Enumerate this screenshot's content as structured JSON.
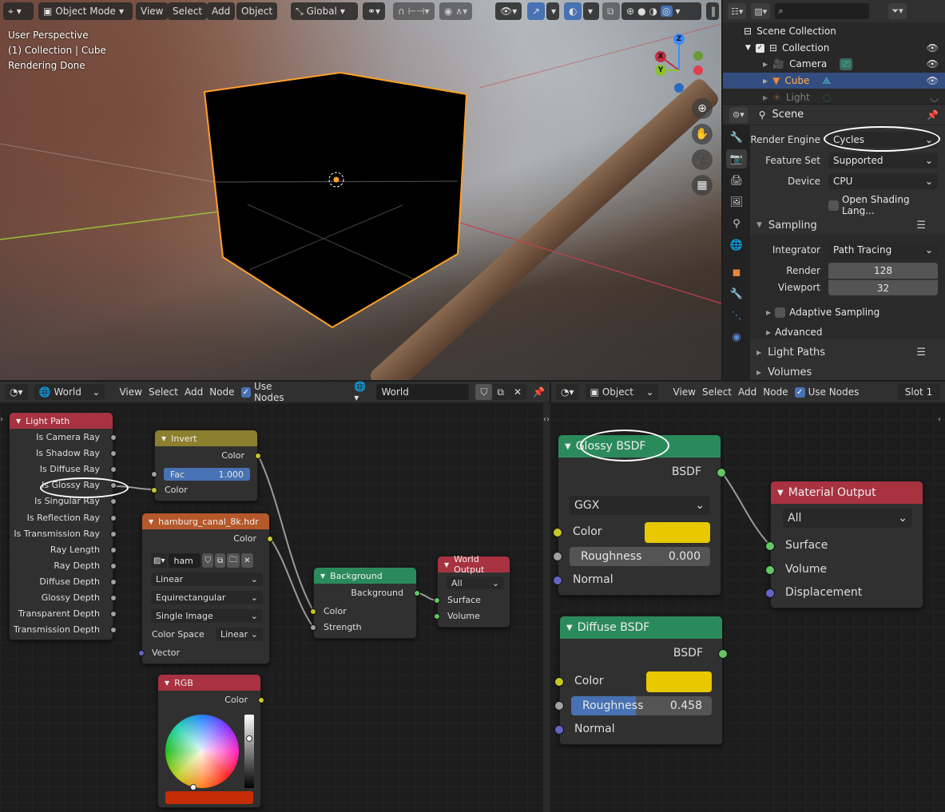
{
  "viewport": {
    "toolbar": {
      "mode": "Object Mode",
      "menus": [
        "View",
        "Select",
        "Add",
        "Object"
      ],
      "transform_orientation": "Global"
    },
    "overlay_text": [
      "User Perspective",
      "(1) Collection | Cube",
      "Rendering Done"
    ],
    "gizmo_axes": [
      "X",
      "Y",
      "Z"
    ],
    "nav_icons": [
      "zoom-icon",
      "hand-pan-icon",
      "camera-icon",
      "grid-ortho-icon"
    ]
  },
  "outliner": {
    "items": [
      {
        "label": "Scene Collection",
        "icon": "collection-icon"
      },
      {
        "label": "Collection",
        "icon": "collection-icon",
        "checked": true
      },
      {
        "label": "Camera",
        "icon": "camera-icon"
      },
      {
        "label": "Cube",
        "icon": "mesh-icon",
        "selected": true
      },
      {
        "label": "Light",
        "icon": "light-icon"
      }
    ]
  },
  "properties": {
    "context": "Scene",
    "render_engine_label": "Render Engine",
    "render_engine": "Cycles",
    "feature_set_label": "Feature Set",
    "feature_set": "Supported",
    "device_label": "Device",
    "device": "CPU",
    "osl_label": "Open Shading Lang...",
    "sampling": {
      "title": "Sampling",
      "integrator_label": "Integrator",
      "integrator": "Path Tracing",
      "render_label": "Render",
      "render": "128",
      "viewport_label": "Viewport",
      "viewport": "32",
      "adaptive_label": "Adaptive Sampling",
      "advanced_label": "Advanced"
    },
    "light_paths": "Light Paths",
    "volumes": "Volumes"
  },
  "world_editor": {
    "type_label": "World",
    "menus": [
      "View",
      "Select",
      "Add",
      "Node"
    ],
    "use_nodes_label": "Use Nodes",
    "world_name": "World",
    "nodes": {
      "light_path": {
        "title": "Light Path",
        "outputs": [
          "Is Camera Ray",
          "Is Shadow Ray",
          "Is Diffuse Ray",
          "Is Glossy Ray",
          "Is Singular Ray",
          "Is Reflection Ray",
          "Is Transmission Ray",
          "Ray Length",
          "Ray Depth",
          "Diffuse Depth",
          "Glossy Depth",
          "Transparent Depth",
          "Transmission Depth"
        ]
      },
      "invert": {
        "title": "Invert",
        "output": "Color",
        "fac_label": "Fac",
        "fac": "1.000",
        "input": "Color"
      },
      "image": {
        "title": "hamburg_canal_8k.hdr",
        "output": "Color",
        "image_name": "ham",
        "interpolation": "Linear",
        "projection": "Equirectangular",
        "source": "Single Image",
        "color_space_label": "Color Space",
        "color_space": "Linear",
        "input": "Vector"
      },
      "background": {
        "title": "Background",
        "output": "Background",
        "inputs": [
          "Color",
          "Strength"
        ]
      },
      "world_output": {
        "title": "World Output",
        "target": "All",
        "inputs": [
          "Surface",
          "Volume"
        ]
      },
      "rgb": {
        "title": "RGB",
        "output": "Color",
        "color": "#c42d05"
      }
    }
  },
  "material_editor": {
    "type_label": "Object",
    "menus": [
      "View",
      "Select",
      "Add",
      "Node"
    ],
    "use_nodes_label": "Use Nodes",
    "slot": "Slot 1",
    "nodes": {
      "glossy": {
        "title": "Glossy BSDF",
        "output": "BSDF",
        "distribution": "GGX",
        "color_label": "Color",
        "color": "#e8c800",
        "roughness_label": "Roughness",
        "roughness": "0.000",
        "normal_label": "Normal"
      },
      "diffuse": {
        "title": "Diffuse BSDF",
        "output": "BSDF",
        "color_label": "Color",
        "color": "#e8c800",
        "roughness_label": "Roughness",
        "roughness": "0.458",
        "roughness_fraction": 0.458,
        "normal_label": "Normal"
      },
      "material_output": {
        "title": "Material Output",
        "target": "All",
        "inputs": [
          "Surface",
          "Volume",
          "Displacement"
        ]
      }
    }
  },
  "colors": {
    "selection_orange": "#ffa028",
    "accent_blue": "#4772b3",
    "shader_green": "#2b8a5c",
    "output_red": "#a83240",
    "color_node_yellow": "#8c7f2d",
    "texture_orange": "#b5582a"
  }
}
